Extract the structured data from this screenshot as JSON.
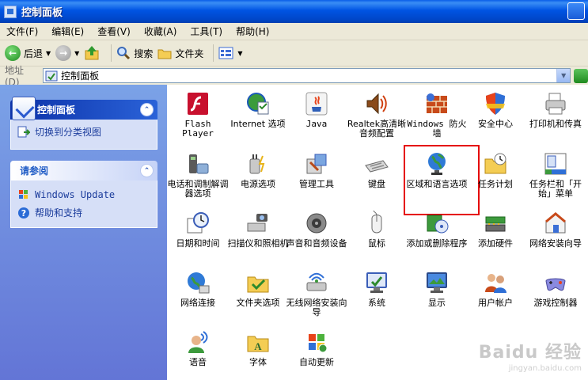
{
  "window": {
    "title": "控制面板"
  },
  "menu": [
    "文件(F)",
    "编辑(E)",
    "查看(V)",
    "收藏(A)",
    "工具(T)",
    "帮助(H)"
  ],
  "toolbar": {
    "back": "后退",
    "search": "搜索",
    "folders": "文件夹"
  },
  "address": {
    "label": "地址(D)",
    "value": "控制面板"
  },
  "sidebar": {
    "control_panel": {
      "title": "控制面板",
      "switch_view": "切换到分类视图"
    },
    "see_also": {
      "title": "请参阅",
      "windows_update": "Windows Update",
      "help": "帮助和支持"
    }
  },
  "items": [
    {
      "label": "Flash Player",
      "icon": "flash-icon"
    },
    {
      "label": "Internet 选项",
      "icon": "internet-options-icon"
    },
    {
      "label": "Java",
      "icon": "java-icon"
    },
    {
      "label": "Realtek高清晰音频配置",
      "icon": "speaker-icon"
    },
    {
      "label": "Windows 防火墙",
      "icon": "firewall-icon"
    },
    {
      "label": "安全中心",
      "icon": "shield-icon"
    },
    {
      "label": "打印机和传真",
      "icon": "printer-icon"
    },
    {
      "label": "电话和调制解调器选项",
      "icon": "phone-icon"
    },
    {
      "label": "电源选项",
      "icon": "power-icon"
    },
    {
      "label": "管理工具",
      "icon": "admin-tools-icon"
    },
    {
      "label": "键盘",
      "icon": "keyboard-icon"
    },
    {
      "label": "区域和语言选项",
      "icon": "globe-icon"
    },
    {
      "label": "任务计划",
      "icon": "scheduled-tasks-icon"
    },
    {
      "label": "任务栏和「开始」菜单",
      "icon": "taskbar-icon"
    },
    {
      "label": "日期和时间",
      "icon": "clock-icon"
    },
    {
      "label": "扫描仪和照相机",
      "icon": "scanner-icon"
    },
    {
      "label": "声音和音频设备",
      "icon": "sound-icon"
    },
    {
      "label": "鼠标",
      "icon": "mouse-icon"
    },
    {
      "label": "添加或删除程序",
      "icon": "add-remove-icon"
    },
    {
      "label": "添加硬件",
      "icon": "add-hardware-icon"
    },
    {
      "label": "网络安装向导",
      "icon": "network-wizard-icon"
    },
    {
      "label": "网络连接",
      "icon": "network-icon"
    },
    {
      "label": "文件夹选项",
      "icon": "folder-options-icon"
    },
    {
      "label": "无线网络安装向导",
      "icon": "wireless-icon"
    },
    {
      "label": "系统",
      "icon": "system-icon"
    },
    {
      "label": "显示",
      "icon": "display-icon"
    },
    {
      "label": "用户帐户",
      "icon": "users-icon"
    },
    {
      "label": "游戏控制器",
      "icon": "gamepad-icon"
    },
    {
      "label": "语音",
      "icon": "speech-icon"
    },
    {
      "label": "字体",
      "icon": "fonts-icon"
    },
    {
      "label": "自动更新",
      "icon": "windows-update-icon"
    }
  ],
  "highlighted_item": "区域和语言选项",
  "watermark": {
    "text": "Baidu 经验",
    "sub": "jingyan.baidu.com"
  }
}
